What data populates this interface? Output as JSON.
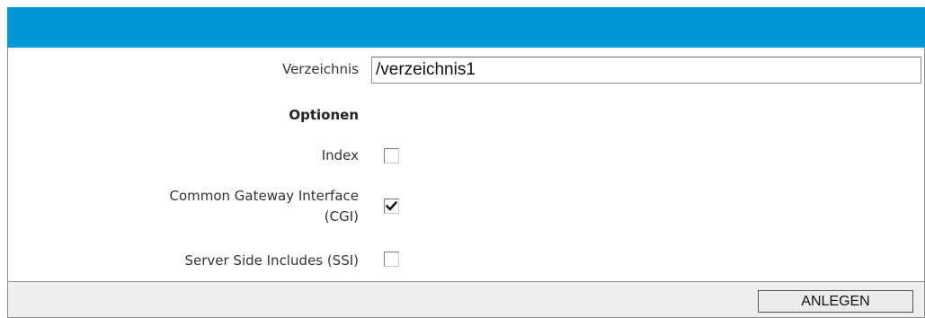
{
  "form": {
    "directory_label": "Verzeichnis",
    "directory_value": "/verzeichnis1",
    "options_heading": "Optionen",
    "options": [
      {
        "label": "Index",
        "checked": false
      },
      {
        "label_line1": "Common Gateway Interface",
        "label_line2": "(CGI)",
        "checked": true
      },
      {
        "label": "Server Side Includes (SSI)",
        "checked": false
      }
    ],
    "submit_label": "ANLEGEN"
  },
  "colors": {
    "header": "#0098d8",
    "footer": "#efefef"
  }
}
